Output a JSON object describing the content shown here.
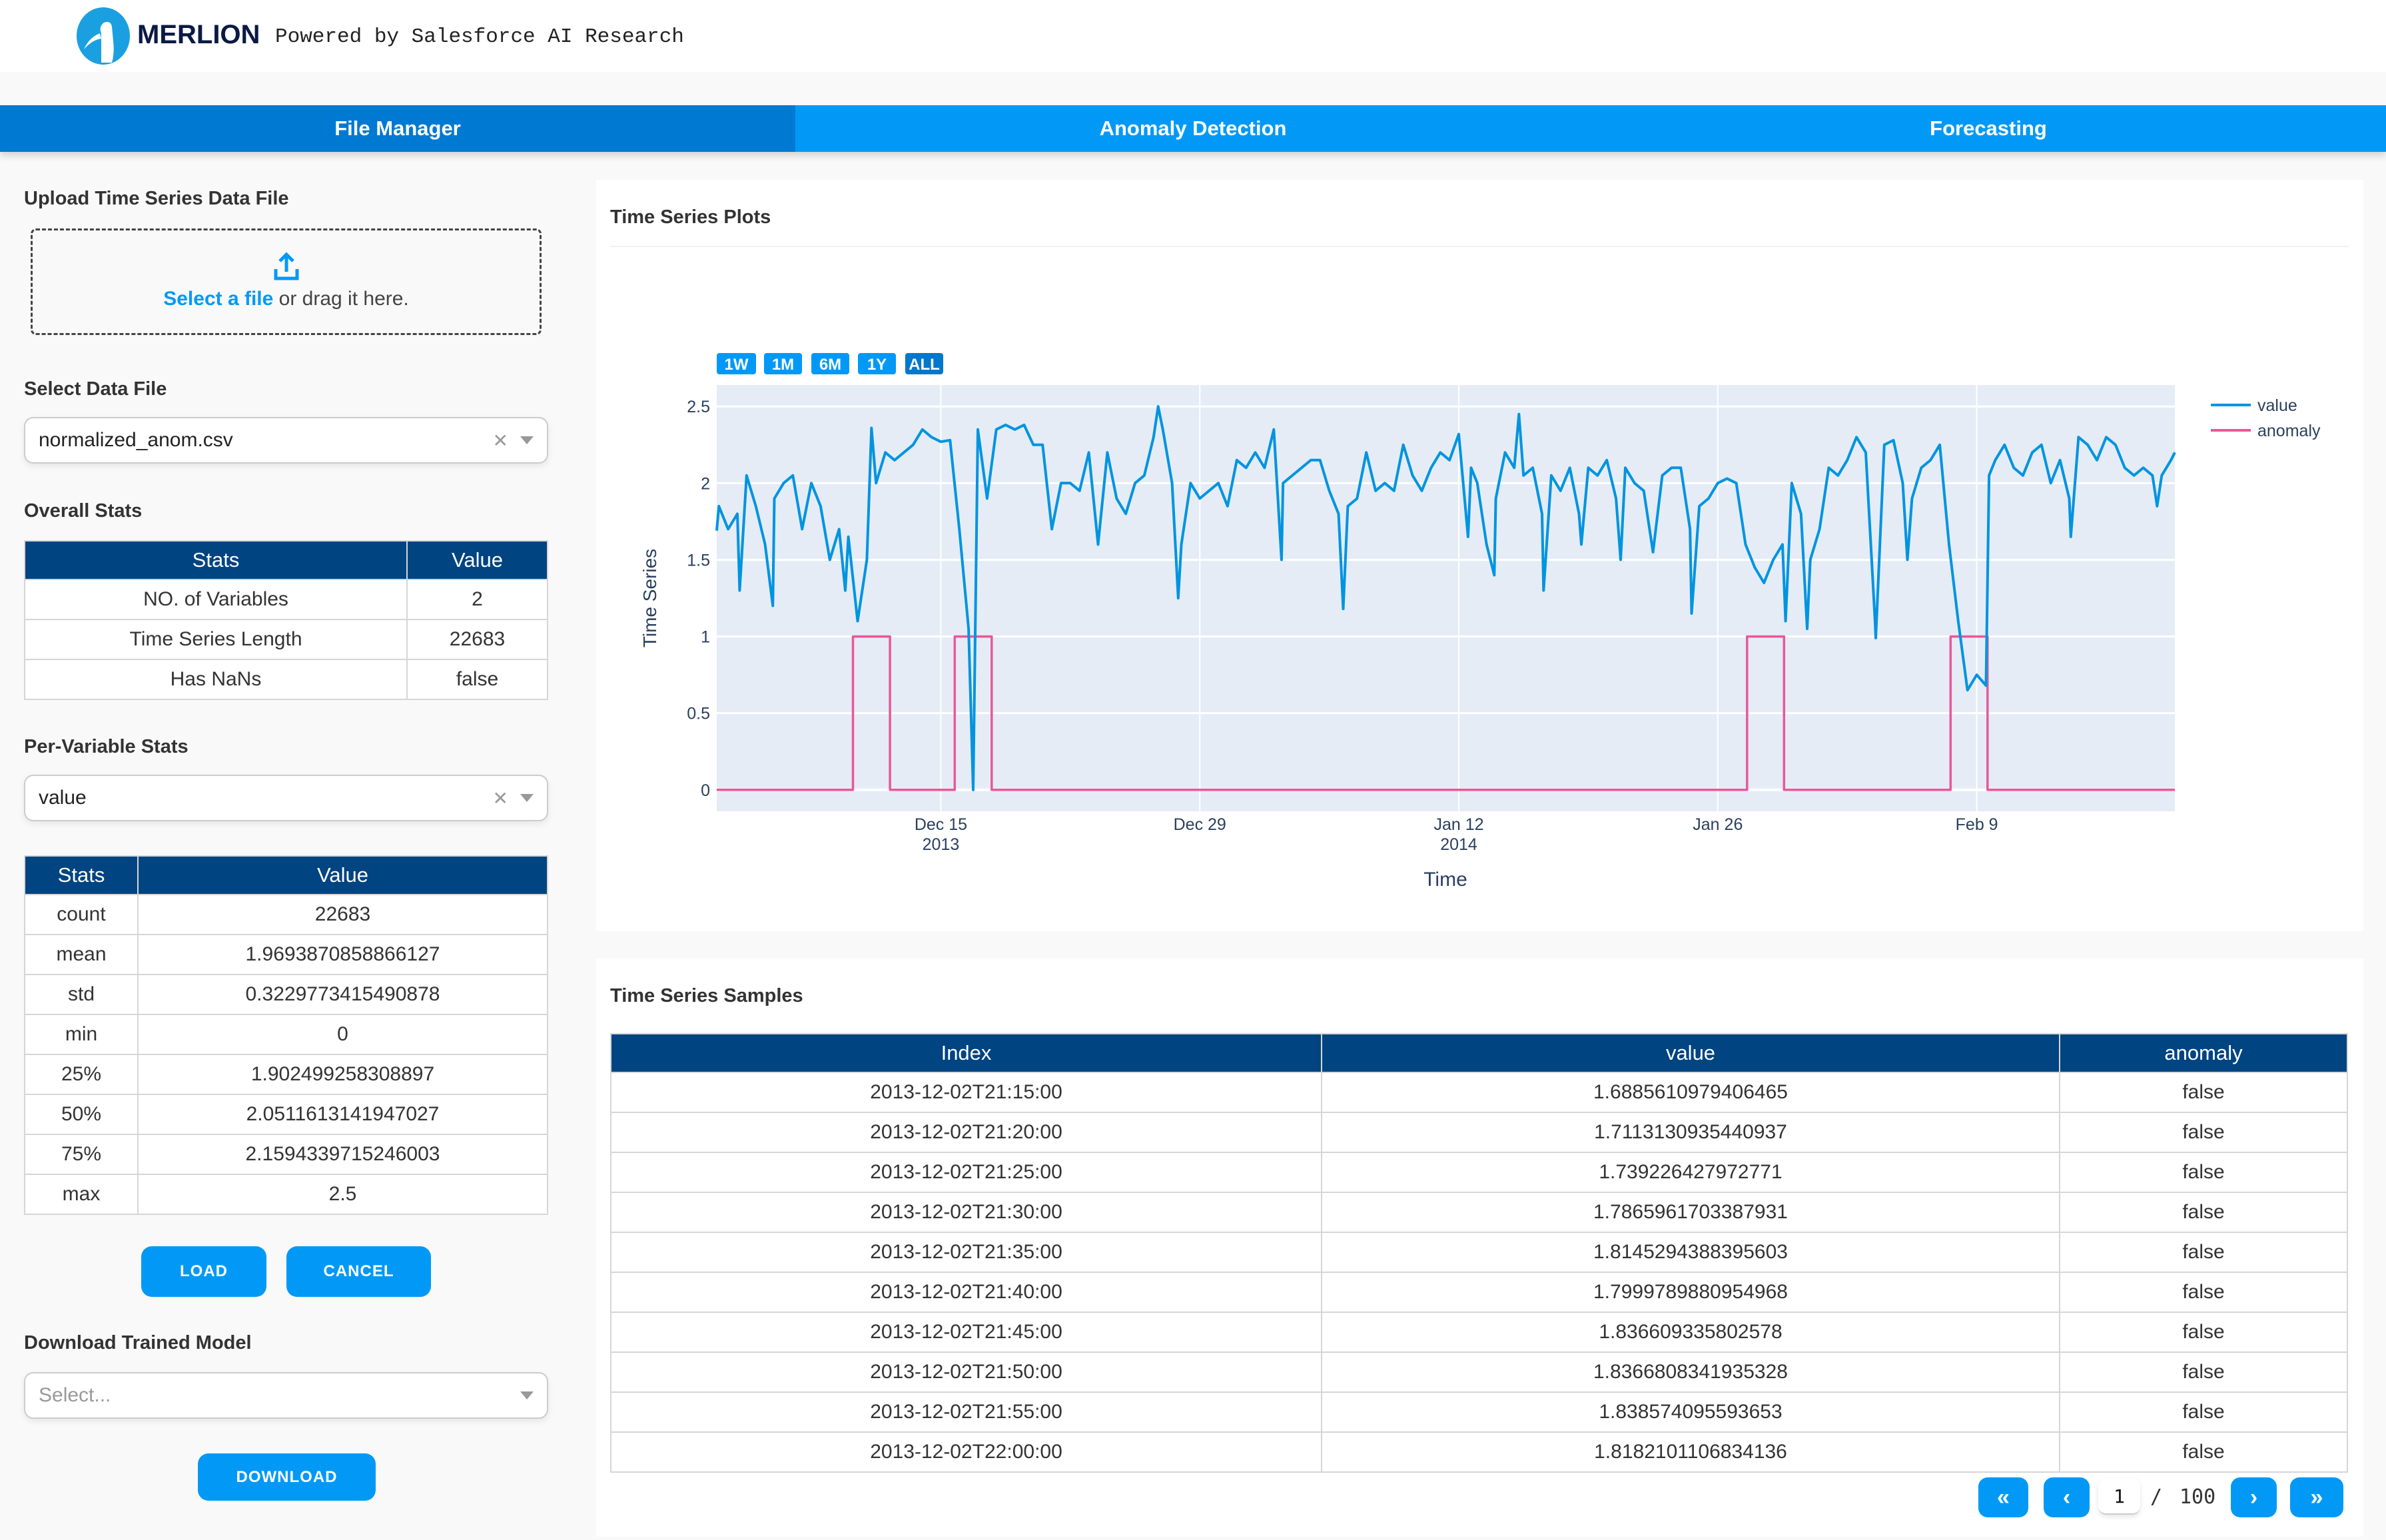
{
  "header": {
    "brand": "MERLION",
    "tagline": "Powered by Salesforce AI Research",
    "logo_icon": "merlion-logo-icon"
  },
  "tabs": [
    {
      "label": "File Manager",
      "active": true
    },
    {
      "label": "Anomaly Detection",
      "active": false
    },
    {
      "label": "Forecasting",
      "active": false
    }
  ],
  "left": {
    "upload_title": "Upload Time Series Data File",
    "upload_link": "Select a file",
    "upload_rest": " or drag it here.",
    "select_file_title": "Select Data File",
    "select_file_value": "normalized_anom.csv",
    "overall_title": "Overall Stats",
    "overall_headers": [
      "Stats",
      "Value"
    ],
    "overall_rows": [
      [
        "NO. of Variables",
        "2"
      ],
      [
        "Time Series Length",
        "22683"
      ],
      [
        "Has NaNs",
        "false"
      ]
    ],
    "per_var_title": "Per-Variable Stats",
    "per_var_value": "value",
    "per_var_headers": [
      "Stats",
      "Value"
    ],
    "per_var_rows": [
      [
        "count",
        "22683"
      ],
      [
        "mean",
        "1.9693870858866127"
      ],
      [
        "std",
        "0.3229773415490878"
      ],
      [
        "min",
        "0"
      ],
      [
        "25%",
        "1.902499258308897"
      ],
      [
        "50%",
        "2.0511613141947027"
      ],
      [
        "75%",
        "2.1594339715246003"
      ],
      [
        "max",
        "2.5"
      ]
    ],
    "load_label": "LOAD",
    "cancel_label": "CANCEL",
    "download_title": "Download Trained Model",
    "download_placeholder": "Select...",
    "download_label": "DOWNLOAD"
  },
  "plots": {
    "title": "Time Series Plots",
    "range_buttons": [
      "1W",
      "1M",
      "6M",
      "1Y",
      "ALL"
    ],
    "active_range": "ALL"
  },
  "chart_data": {
    "type": "line",
    "xlabel": "Time",
    "ylabel": "Time Series",
    "xlim": [
      "2013-12-02T21:15",
      "2014-02-19T17:00"
    ],
    "ylim": [
      -0.14,
      2.64
    ],
    "yticks": [
      0,
      0.5,
      1,
      1.5,
      2,
      2.5
    ],
    "ytick_labels": [
      "0",
      "0.5",
      "1",
      "1.5",
      "2",
      "2.5"
    ],
    "xticks": [
      {
        "date": "2013-12-15T00:00",
        "label": "Dec 15",
        "sub": "2013"
      },
      {
        "date": "2013-12-29T00:00",
        "label": "Dec 29",
        "sub": ""
      },
      {
        "date": "2014-01-12T00:00",
        "label": "Jan 12",
        "sub": "2014"
      },
      {
        "date": "2014-01-26T00:00",
        "label": "Jan 26",
        "sub": ""
      },
      {
        "date": "2014-02-09T00:00",
        "label": "Feb 9",
        "sub": ""
      }
    ],
    "grid": true,
    "legend_position": "top-right",
    "background": "#e5ecf6",
    "series": [
      {
        "name": "value",
        "color": "#0094e0",
        "points": [
          [
            "2013-12-02T21:15",
            1.69
          ],
          [
            "2013-12-03T00:00",
            1.85
          ],
          [
            "2013-12-03T12:00",
            1.7
          ],
          [
            "2013-12-04T00:00",
            1.8
          ],
          [
            "2013-12-04T03:00",
            1.3
          ],
          [
            "2013-12-04T12:00",
            2.05
          ],
          [
            "2013-12-05T00:00",
            1.85
          ],
          [
            "2013-12-05T12:00",
            1.6
          ],
          [
            "2013-12-05T22:00",
            1.2
          ],
          [
            "2013-12-06T00:00",
            1.9
          ],
          [
            "2013-12-06T12:00",
            2.0
          ],
          [
            "2013-12-07T00:00",
            2.05
          ],
          [
            "2013-12-07T12:00",
            1.7
          ],
          [
            "2013-12-08T00:00",
            2.0
          ],
          [
            "2013-12-08T12:00",
            1.85
          ],
          [
            "2013-12-09T00:00",
            1.5
          ],
          [
            "2013-12-09T12:00",
            1.7
          ],
          [
            "2013-12-09T20:00",
            1.3
          ],
          [
            "2013-12-10T00:00",
            1.65
          ],
          [
            "2013-12-10T12:00",
            1.1
          ],
          [
            "2013-12-11T00:00",
            1.5
          ],
          [
            "2013-12-11T06:00",
            2.36
          ],
          [
            "2013-12-11T12:00",
            2.0
          ],
          [
            "2013-12-12T00:00",
            2.2
          ],
          [
            "2013-12-12T12:00",
            2.15
          ],
          [
            "2013-12-13T00:00",
            2.2
          ],
          [
            "2013-12-13T12:00",
            2.25
          ],
          [
            "2013-12-14T00:00",
            2.35
          ],
          [
            "2013-12-14T12:00",
            2.3
          ],
          [
            "2013-12-15T00:00",
            2.27
          ],
          [
            "2013-12-15T12:00",
            2.28
          ],
          [
            "2013-12-16T00:00",
            1.7
          ],
          [
            "2013-12-16T12:00",
            1.05
          ],
          [
            "2013-12-16T18:00",
            0
          ],
          [
            "2013-12-17T00:00",
            2.35
          ],
          [
            "2013-12-17T12:00",
            1.9
          ],
          [
            "2013-12-18T00:00",
            2.35
          ],
          [
            "2013-12-18T12:00",
            2.38
          ],
          [
            "2013-12-19T00:00",
            2.35
          ],
          [
            "2013-12-19T12:00",
            2.38
          ],
          [
            "2013-12-20T00:00",
            2.25
          ],
          [
            "2013-12-20T12:00",
            2.25
          ],
          [
            "2013-12-21T00:00",
            1.7
          ],
          [
            "2013-12-21T12:00",
            2.0
          ],
          [
            "2013-12-22T00:00",
            2.0
          ],
          [
            "2013-12-22T12:00",
            1.95
          ],
          [
            "2013-12-23T00:00",
            2.2
          ],
          [
            "2013-12-23T12:00",
            1.6
          ],
          [
            "2013-12-24T00:00",
            2.2
          ],
          [
            "2013-12-24T12:00",
            1.9
          ],
          [
            "2013-12-25T00:00",
            1.8
          ],
          [
            "2013-12-25T12:00",
            2.0
          ],
          [
            "2013-12-26T00:00",
            2.05
          ],
          [
            "2013-12-26T12:00",
            2.3
          ],
          [
            "2013-12-26T18:00",
            2.5
          ],
          [
            "2013-12-27T00:00",
            2.35
          ],
          [
            "2013-12-27T12:00",
            2.0
          ],
          [
            "2013-12-27T20:00",
            1.25
          ],
          [
            "2013-12-28T00:00",
            1.6
          ],
          [
            "2013-12-28T12:00",
            2.0
          ],
          [
            "2013-12-29T00:00",
            1.9
          ],
          [
            "2013-12-29T12:00",
            1.95
          ],
          [
            "2013-12-30T00:00",
            2.0
          ],
          [
            "2013-12-30T12:00",
            1.85
          ],
          [
            "2013-12-31T00:00",
            2.15
          ],
          [
            "2013-12-31T12:00",
            2.1
          ],
          [
            "2014-01-01T00:00",
            2.2
          ],
          [
            "2014-01-01T12:00",
            2.1
          ],
          [
            "2014-01-02T00:00",
            2.35
          ],
          [
            "2014-01-02T10:00",
            1.5
          ],
          [
            "2014-01-02T12:00",
            2.0
          ],
          [
            "2014-01-03T00:00",
            2.05
          ],
          [
            "2014-01-03T12:00",
            2.1
          ],
          [
            "2014-01-04T00:00",
            2.15
          ],
          [
            "2014-01-04T12:00",
            2.15
          ],
          [
            "2014-01-05T00:00",
            1.95
          ],
          [
            "2014-01-05T12:00",
            1.8
          ],
          [
            "2014-01-05T18:00",
            1.18
          ],
          [
            "2014-01-06T00:00",
            1.85
          ],
          [
            "2014-01-06T12:00",
            1.9
          ],
          [
            "2014-01-07T00:00",
            2.2
          ],
          [
            "2014-01-07T12:00",
            1.95
          ],
          [
            "2014-01-08T00:00",
            2.0
          ],
          [
            "2014-01-08T12:00",
            1.95
          ],
          [
            "2014-01-09T00:00",
            2.25
          ],
          [
            "2014-01-09T12:00",
            2.05
          ],
          [
            "2014-01-10T00:00",
            1.95
          ],
          [
            "2014-01-10T12:00",
            2.1
          ],
          [
            "2014-01-11T00:00",
            2.2
          ],
          [
            "2014-01-11T12:00",
            2.15
          ],
          [
            "2014-01-12T00:00",
            2.32
          ],
          [
            "2014-01-12T12:00",
            1.65
          ],
          [
            "2014-01-12T16:00",
            2.1
          ],
          [
            "2014-01-13T00:00",
            2.0
          ],
          [
            "2014-01-13T12:00",
            1.6
          ],
          [
            "2014-01-13T22:00",
            1.4
          ],
          [
            "2014-01-14T00:00",
            1.9
          ],
          [
            "2014-01-14T12:00",
            2.2
          ],
          [
            "2014-01-15T00:00",
            2.1
          ],
          [
            "2014-01-15T06:00",
            2.45
          ],
          [
            "2014-01-15T12:00",
            2.05
          ],
          [
            "2014-01-16T00:00",
            2.1
          ],
          [
            "2014-01-16T12:00",
            1.8
          ],
          [
            "2014-01-16T14:00",
            1.3
          ],
          [
            "2014-01-17T00:00",
            2.05
          ],
          [
            "2014-01-17T12:00",
            1.95
          ],
          [
            "2014-01-18T00:00",
            2.1
          ],
          [
            "2014-01-18T12:00",
            1.8
          ],
          [
            "2014-01-18T15:00",
            1.6
          ],
          [
            "2014-01-19T00:00",
            2.1
          ],
          [
            "2014-01-19T12:00",
            2.05
          ],
          [
            "2014-01-20T00:00",
            2.15
          ],
          [
            "2014-01-20T12:00",
            1.9
          ],
          [
            "2014-01-20T18:00",
            1.5
          ],
          [
            "2014-01-21T00:00",
            2.1
          ],
          [
            "2014-01-21T12:00",
            2.0
          ],
          [
            "2014-01-22T00:00",
            1.95
          ],
          [
            "2014-01-22T12:00",
            1.55
          ],
          [
            "2014-01-23T00:00",
            2.05
          ],
          [
            "2014-01-23T12:00",
            2.1
          ],
          [
            "2014-01-24T00:00",
            2.1
          ],
          [
            "2014-01-24T12:00",
            1.7
          ],
          [
            "2014-01-24T14:00",
            1.15
          ],
          [
            "2014-01-25T00:00",
            1.85
          ],
          [
            "2014-01-25T12:00",
            1.9
          ],
          [
            "2014-01-26T00:00",
            2.0
          ],
          [
            "2014-01-26T12:00",
            2.03
          ],
          [
            "2014-01-27T00:00",
            2.0
          ],
          [
            "2014-01-27T12:00",
            1.6
          ],
          [
            "2014-01-28T00:00",
            1.45
          ],
          [
            "2014-01-28T12:00",
            1.35
          ],
          [
            "2014-01-29T00:00",
            1.5
          ],
          [
            "2014-01-29T12:00",
            1.6
          ],
          [
            "2014-01-29T16:00",
            1.1
          ],
          [
            "2014-01-30T00:00",
            2.0
          ],
          [
            "2014-01-30T12:00",
            1.8
          ],
          [
            "2014-01-30T20:00",
            1.05
          ],
          [
            "2014-01-31T00:00",
            1.5
          ],
          [
            "2014-01-31T12:00",
            1.7
          ],
          [
            "2014-02-01T00:00",
            2.1
          ],
          [
            "2014-02-01T12:00",
            2.05
          ],
          [
            "2014-02-02T00:00",
            2.15
          ],
          [
            "2014-02-02T12:00",
            2.3
          ],
          [
            "2014-02-03T00:00",
            2.2
          ],
          [
            "2014-02-03T12:00",
            1.1
          ],
          [
            "2014-02-03T13:00",
            0.99
          ],
          [
            "2014-02-04T00:00",
            2.25
          ],
          [
            "2014-02-04T12:00",
            2.28
          ],
          [
            "2014-02-05T00:00",
            2.0
          ],
          [
            "2014-02-05T06:00",
            1.5
          ],
          [
            "2014-02-05T12:00",
            1.9
          ],
          [
            "2014-02-06T00:00",
            2.1
          ],
          [
            "2014-02-06T12:00",
            2.15
          ],
          [
            "2014-02-07T00:00",
            2.25
          ],
          [
            "2014-02-07T12:00",
            1.6
          ],
          [
            "2014-02-08T00:00",
            1.1
          ],
          [
            "2014-02-08T12:00",
            0.65
          ],
          [
            "2014-02-09T00:00",
            0.75
          ],
          [
            "2014-02-09T12:00",
            0.68
          ],
          [
            "2014-02-09T16:00",
            2.05
          ],
          [
            "2014-02-10T00:00",
            2.15
          ],
          [
            "2014-02-10T12:00",
            2.25
          ],
          [
            "2014-02-11T00:00",
            2.1
          ],
          [
            "2014-02-11T12:00",
            2.05
          ],
          [
            "2014-02-12T00:00",
            2.2
          ],
          [
            "2014-02-12T12:00",
            2.25
          ],
          [
            "2014-02-13T00:00",
            2.0
          ],
          [
            "2014-02-13T12:00",
            2.15
          ],
          [
            "2014-02-14T00:00",
            1.9
          ],
          [
            "2014-02-14T02:00",
            1.65
          ],
          [
            "2014-02-14T12:00",
            2.3
          ],
          [
            "2014-02-15T00:00",
            2.25
          ],
          [
            "2014-02-15T12:00",
            2.15
          ],
          [
            "2014-02-16T00:00",
            2.3
          ],
          [
            "2014-02-16T12:00",
            2.25
          ],
          [
            "2014-02-17T00:00",
            2.1
          ],
          [
            "2014-02-17T12:00",
            2.05
          ],
          [
            "2014-02-18T00:00",
            2.1
          ],
          [
            "2014-02-18T12:00",
            2.05
          ],
          [
            "2014-02-18T18:00",
            1.85
          ],
          [
            "2014-02-19T00:00",
            2.05
          ],
          [
            "2014-02-19T12:00",
            2.15
          ],
          [
            "2014-02-19T17:00",
            2.2
          ]
        ]
      },
      {
        "name": "anomaly",
        "color": "#e8589a",
        "points": [
          [
            "2013-12-02T21:15",
            0
          ],
          [
            "2013-12-10T06:00",
            0
          ],
          [
            "2013-12-10T06:00",
            1
          ],
          [
            "2013-12-12T06:00",
            1
          ],
          [
            "2013-12-12T06:00",
            0
          ],
          [
            "2013-12-15T18:00",
            0
          ],
          [
            "2013-12-15T18:00",
            1
          ],
          [
            "2013-12-17T18:00",
            1
          ],
          [
            "2013-12-17T18:00",
            0
          ],
          [
            "2014-01-27T14:00",
            0
          ],
          [
            "2014-01-27T14:00",
            1
          ],
          [
            "2014-01-29T14:00",
            1
          ],
          [
            "2014-01-29T14:00",
            0
          ],
          [
            "2014-02-07T14:00",
            0
          ],
          [
            "2014-02-07T14:00",
            1
          ],
          [
            "2014-02-09T14:00",
            1
          ],
          [
            "2014-02-09T14:00",
            0
          ],
          [
            "2014-02-19T17:00",
            0
          ]
        ]
      }
    ]
  },
  "samples": {
    "title": "Time Series Samples",
    "headers": [
      "Index",
      "value",
      "anomaly"
    ],
    "rows": [
      [
        "2013-12-02T21:15:00",
        "1.6885610979406465",
        "false"
      ],
      [
        "2013-12-02T21:20:00",
        "1.7113130935440937",
        "false"
      ],
      [
        "2013-12-02T21:25:00",
        "1.739226427972771",
        "false"
      ],
      [
        "2013-12-02T21:30:00",
        "1.7865961703387931",
        "false"
      ],
      [
        "2013-12-02T21:35:00",
        "1.8145294388395603",
        "false"
      ],
      [
        "2013-12-02T21:40:00",
        "1.7999789880954968",
        "false"
      ],
      [
        "2013-12-02T21:45:00",
        "1.836609335802578",
        "false"
      ],
      [
        "2013-12-02T21:50:00",
        "1.8366808341935328",
        "false"
      ],
      [
        "2013-12-02T21:55:00",
        "1.838574095593653",
        "false"
      ],
      [
        "2013-12-02T22:00:00",
        "1.8182101106834136",
        "false"
      ]
    ],
    "pager": {
      "first": "«",
      "prev": "‹",
      "current": "1",
      "separator": "/",
      "total": "100",
      "next": "›",
      "last": "»"
    }
  }
}
